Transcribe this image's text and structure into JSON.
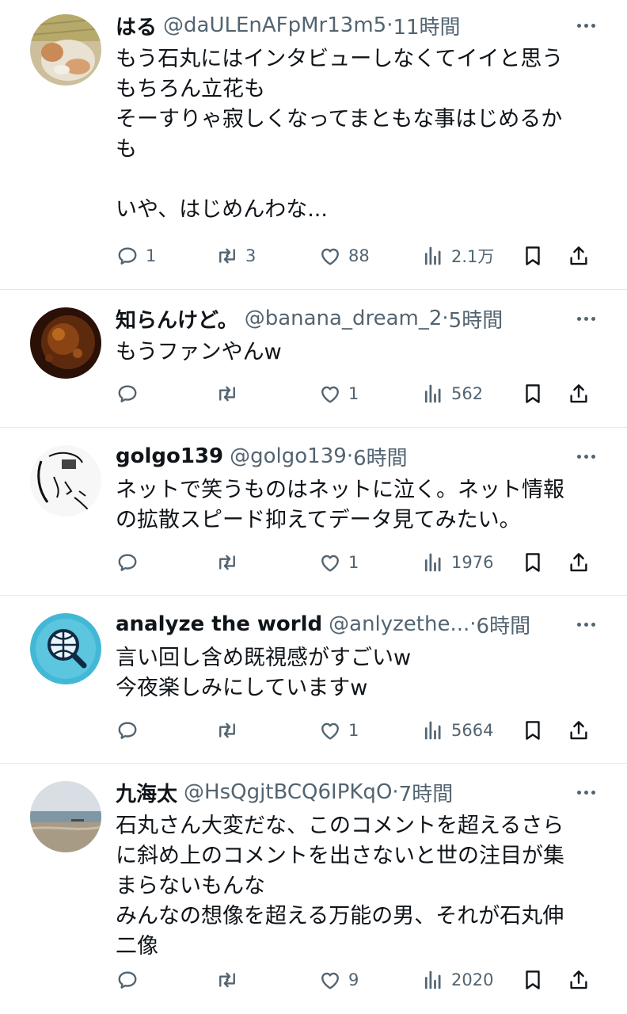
{
  "tweets": [
    {
      "name": "はる",
      "handle": "@daULEnAFpMr13m5",
      "sep": "·",
      "time": "11時間",
      "lines": [
        "もう石丸にはインタビューしなくてイイと思う",
        "もちろん立花も",
        "そーすりゃ寂しくなってまともな事はじめるか",
        "も",
        "",
        "いや、はじめんわな..."
      ],
      "replies": "1",
      "reposts": "3",
      "likes": "88",
      "views": "2.1万",
      "avatar": "cat-photo"
    },
    {
      "name": "知らんけど。",
      "handle": "@banana_dream_2",
      "sep": "·",
      "time": "5時間",
      "lines": [
        "もうファンやんw"
      ],
      "replies": "",
      "reposts": "",
      "likes": "1",
      "views": "562",
      "avatar": "dark-orange-photo"
    },
    {
      "name": "golgo139",
      "handle": "@golgo139",
      "sep": "·",
      "time": "6時間",
      "lines": [
        "ネットで笑うものはネットに泣く。ネット情報",
        "の拡散スピード抑えてデータ見てみたい。"
      ],
      "replies": "",
      "reposts": "",
      "likes": "1",
      "views": "1976",
      "avatar": "sketch-face"
    },
    {
      "name": "analyze the world",
      "handle": "@anlyzethe...",
      "sep": "·",
      "time": "6時間",
      "lines": [
        "言い回し含め既視感がすごいw",
        "今夜楽しみにしていますw"
      ],
      "replies": "",
      "reposts": "",
      "likes": "1",
      "views": "5664",
      "avatar": "globe-magnifier-icon"
    },
    {
      "name": "九海太",
      "handle": "@HsQgjtBCQ6IPKqO",
      "sep": "·",
      "time": "7時間",
      "lines": [
        "石丸さん大変だな、このコメントを超えるさら",
        "に斜め上のコメントを出さないと世の注目が集",
        "まらないもんな",
        "みんなの想像を超える万能の男、それが石丸伸",
        "二像"
      ],
      "replies": "",
      "reposts": "",
      "likes": "9",
      "views": "2020",
      "avatar": "beach-photo"
    }
  ],
  "colors": {
    "text": "#0f1419",
    "secondary": "#536471",
    "divider": "#e6e9ec",
    "background": "#ffffff"
  }
}
